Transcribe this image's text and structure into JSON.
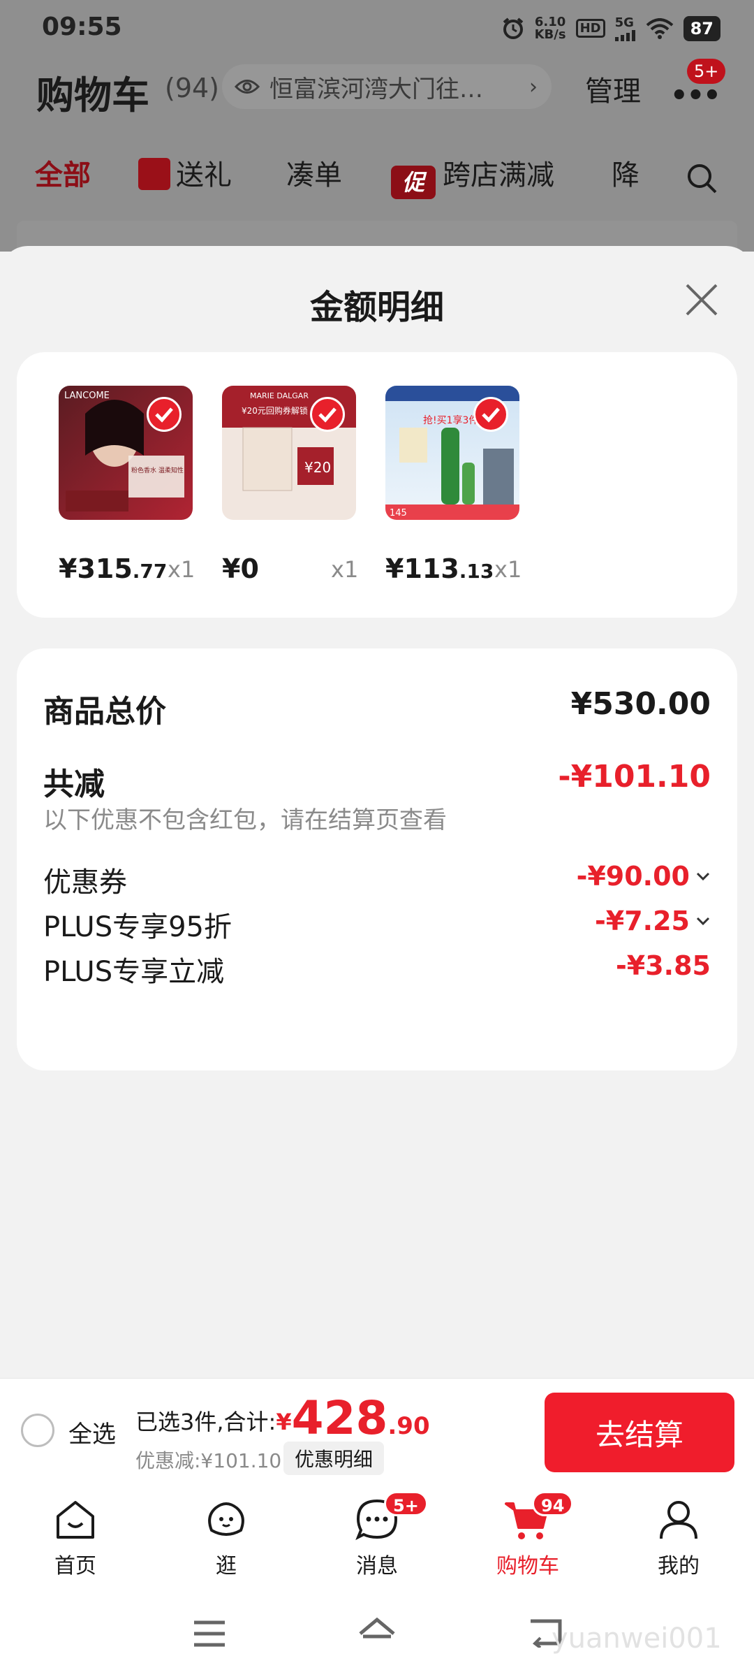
{
  "status_bar": {
    "time": "09:55",
    "speed": "6.10",
    "speed_unit": "KB/s",
    "hd": "HD",
    "network": "5G",
    "battery": "87"
  },
  "background": {
    "title": "购物车",
    "count": "(94)",
    "address": "恒富滨河湾大门往…",
    "manage": "管理",
    "more": "•••",
    "more_badge": "5+",
    "tabs": {
      "all": "全部",
      "gift": "送礼",
      "combine": "凑单",
      "promo_icon": "促",
      "promo": "跨店满减",
      "drop": "降"
    }
  },
  "sheet": {
    "title": "金额明细",
    "products": [
      {
        "name": "lancome",
        "price_int": "¥315",
        "price_dec": ".77",
        "qty": "x1",
        "image_text": "LANCOME",
        "image_sub": "粉色香水 温柔知性"
      },
      {
        "name": "marie-dalgar",
        "price_int": "¥0",
        "price_dec": "",
        "qty": "x1",
        "image_text": "MARIE DALGAR",
        "image_sub": "¥20元回购券解锁"
      },
      {
        "name": "green-serum",
        "price_int": "¥113",
        "price_dec": ".13",
        "qty": "x1",
        "image_text": "抢!买1享3件",
        "image_sub": "145"
      }
    ],
    "summary": {
      "total_label": "商品总价",
      "total_value": "¥530.00",
      "reduce_label": "共减",
      "reduce_value": "-¥101.10",
      "reduce_note": "以下优惠不包含红包，请在结算页查看",
      "items": [
        {
          "label": "优惠券",
          "value": "-¥90.00",
          "expandable": true
        },
        {
          "label": "PLUS专享95折",
          "value": "-¥7.25",
          "expandable": true
        },
        {
          "label": "PLUS专享立减",
          "value": "-¥3.85",
          "expandable": false
        }
      ]
    }
  },
  "checkout": {
    "select_all": "全选",
    "selected_text": "已选3件,合计:",
    "currency": "¥",
    "total_int": "428",
    "total_dec": ".90",
    "discount_text": "优惠减:¥101.10",
    "detail_label": "优惠明细",
    "button": "去结算"
  },
  "nav": {
    "items": [
      {
        "label": "首页",
        "icon": "home-icon"
      },
      {
        "label": "逛",
        "icon": "browse-icon"
      },
      {
        "label": "消息",
        "icon": "message-icon",
        "badge": "5+"
      },
      {
        "label": "购物车",
        "icon": "cart-icon",
        "badge": "94",
        "active": true
      },
      {
        "label": "我的",
        "icon": "profile-icon"
      }
    ]
  },
  "watermark": "yuanwei001",
  "colors": {
    "accent": "#e8202b",
    "button": "#f01d2c",
    "overlay": "#8f8f8f"
  }
}
